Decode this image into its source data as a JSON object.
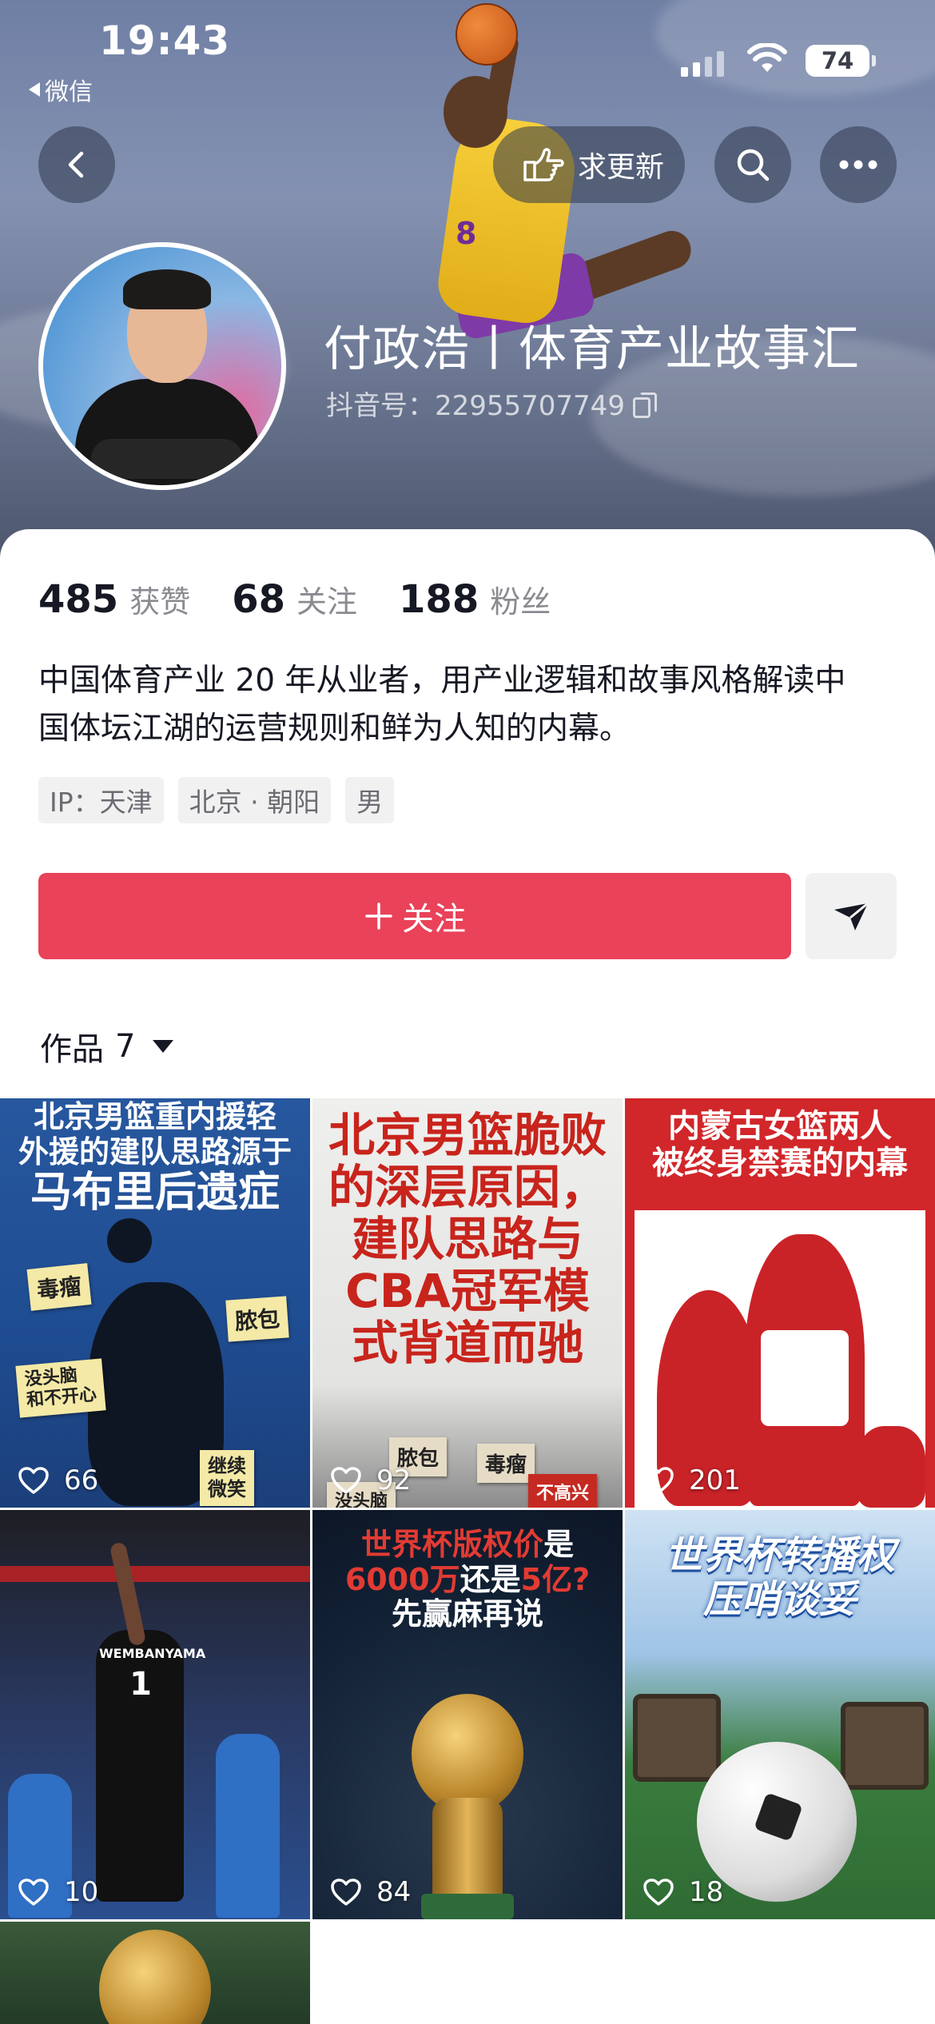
{
  "status_bar": {
    "time": "19:43",
    "back_app": "微信",
    "battery": "74"
  },
  "header": {
    "request_update_label": "求更新"
  },
  "profile": {
    "name": "付政浩丨体育产业故事汇",
    "douyin_id": "抖音号：22955707749",
    "stats": [
      {
        "value": "485",
        "label": "获赞"
      },
      {
        "value": "68",
        "label": "关注"
      },
      {
        "value": "188",
        "label": "粉丝"
      }
    ],
    "bio_line1": "中国体育产业 20 年从业者，用产业逻辑和故事风格解读中",
    "bio_line2": "国体坛江湖的运营规则和鲜为人知的内幕。",
    "tags": [
      "IP：天津",
      "北京 · 朝阳",
      "男"
    ],
    "follow_label": "关注"
  },
  "works": {
    "label": "作品",
    "count": "7",
    "items": [
      {
        "title_lines": [
          "北京男篮重内援轻",
          "外援的建队思路源于",
          "马布里后遗症"
        ],
        "notes": [
          "毒瘤",
          "脓包",
          "没头脑\n和不开心",
          "继续\n微笑"
        ],
        "likes": "66"
      },
      {
        "title_lines": [
          "北京男篮脆败",
          "的深层原因，",
          "建队思路与",
          "CBA冠军模",
          "式背道而驰"
        ],
        "notes": [
          "脓包",
          "毒瘤",
          "不高兴",
          "没头脑"
        ],
        "likes": "92"
      },
      {
        "title_lines": [
          "内蒙古女篮两人",
          "被终身禁赛的内幕"
        ],
        "likes": "201"
      },
      {
        "jersey": "WEMBANYAMA",
        "jersey_number": "1",
        "likes": "10"
      },
      {
        "title_line1_a": "世界杯版权价",
        "title_line1_b": "是",
        "title_line2_a": "6000万",
        "title_line2_b": "还是",
        "title_line2_c": "5亿?",
        "title_line3": "先赢麻再说",
        "likes": "84"
      },
      {
        "title_lines": [
          "世界杯转播权",
          "压哨谈妥"
        ],
        "likes": "18"
      },
      {
        "likes": ""
      }
    ]
  },
  "colors": {
    "follow_button": "#e94259",
    "primary_text": "#161823",
    "secondary_text": "#8a8b91",
    "tag_bg": "#f1f1f2"
  }
}
